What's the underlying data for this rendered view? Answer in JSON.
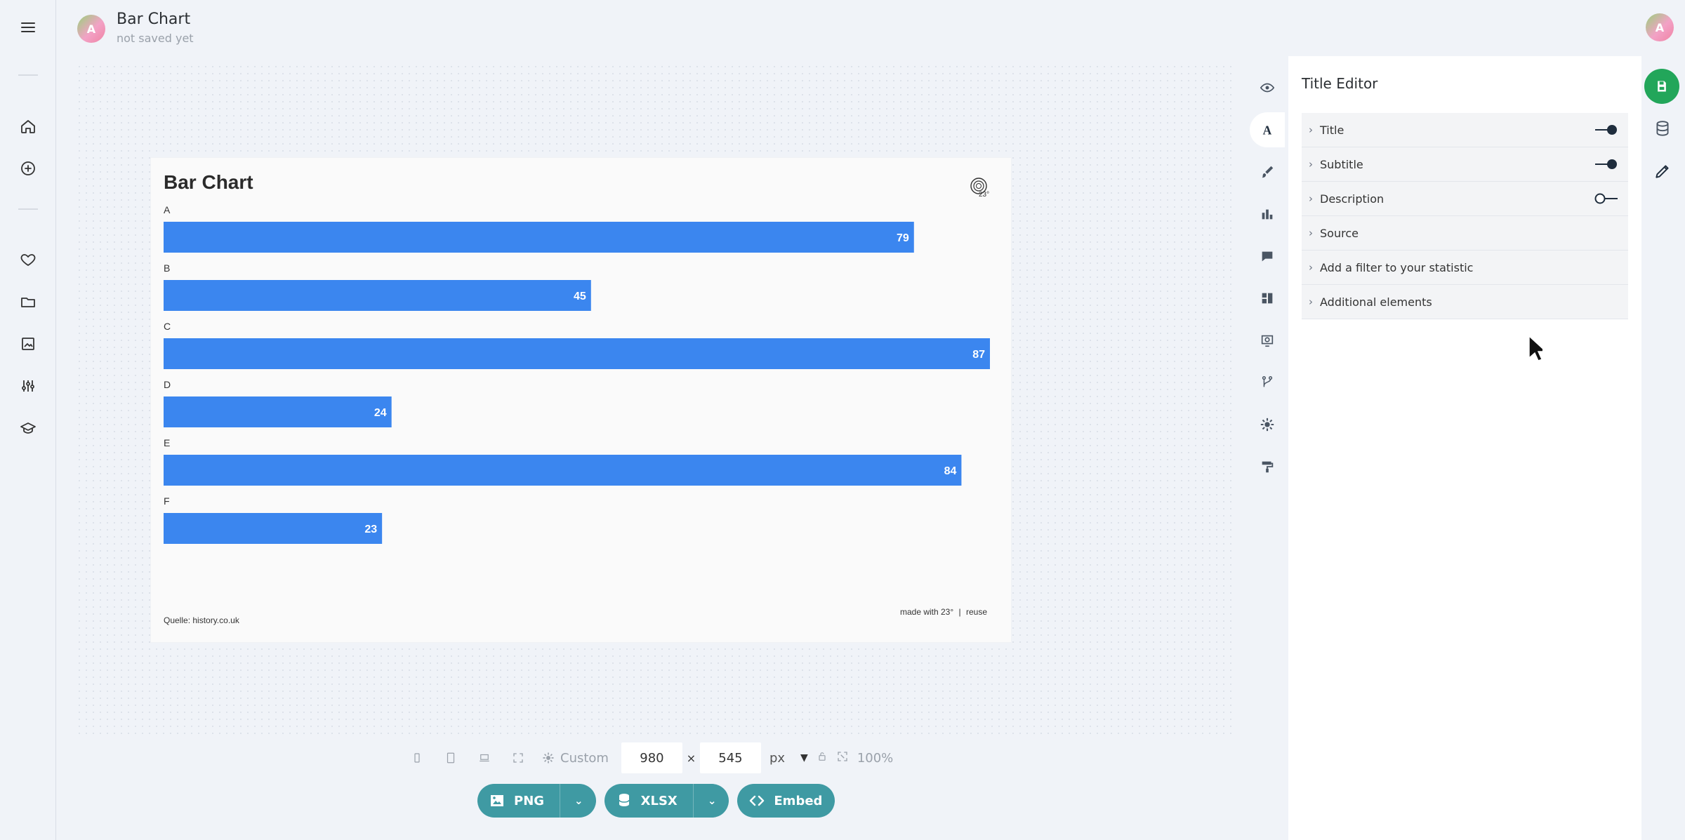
{
  "document": {
    "title": "Bar Chart",
    "status": "not saved yet",
    "avatar_initial": "A"
  },
  "user": {
    "avatar_initial": "A"
  },
  "chart": {
    "title": "Bar Chart",
    "source": "Quelle: history.co.uk",
    "footer_made_with": "made with 23°",
    "footer_sep": "|",
    "footer_reuse": "reuse"
  },
  "chart_data": {
    "type": "bar",
    "orientation": "horizontal",
    "title": "Bar Chart",
    "categories": [
      "A",
      "B",
      "C",
      "D",
      "E",
      "F"
    ],
    "values": [
      79,
      45,
      87,
      24,
      84,
      23
    ],
    "xlim": [
      0,
      87
    ],
    "grid": false,
    "legend": "none",
    "bar_color": "#3b86ef"
  },
  "editor": {
    "title": "Title Editor",
    "items": [
      {
        "label": "Title",
        "toggle": "on"
      },
      {
        "label": "Subtitle",
        "toggle": "on"
      },
      {
        "label": "Description",
        "toggle": "off"
      },
      {
        "label": "Source",
        "toggle": ""
      },
      {
        "label": "Add a filter to your statistic",
        "toggle": ""
      },
      {
        "label": "Additional elements",
        "toggle": ""
      }
    ]
  },
  "sizing": {
    "custom_label": "Custom",
    "width_value": "980",
    "height_value": "545",
    "times": "×",
    "unit": "px",
    "zoom": "100%"
  },
  "exports": {
    "png": "PNG",
    "xlsx": "XLSX",
    "embed": "Embed"
  },
  "icons": {
    "menu": "menu-icon",
    "home": "home-icon",
    "add": "add-icon",
    "favorites": "heart-icon",
    "folder": "folder-icon",
    "image": "image-icon",
    "sliders": "sliders-icon",
    "learn": "graduation-cap-icon",
    "save": "save-icon",
    "database": "database-icon",
    "edit": "pencil-icon"
  },
  "colors": {
    "bar": "#3b86ef",
    "export_button": "#3f9aa3",
    "save_button": "#22a65a"
  }
}
